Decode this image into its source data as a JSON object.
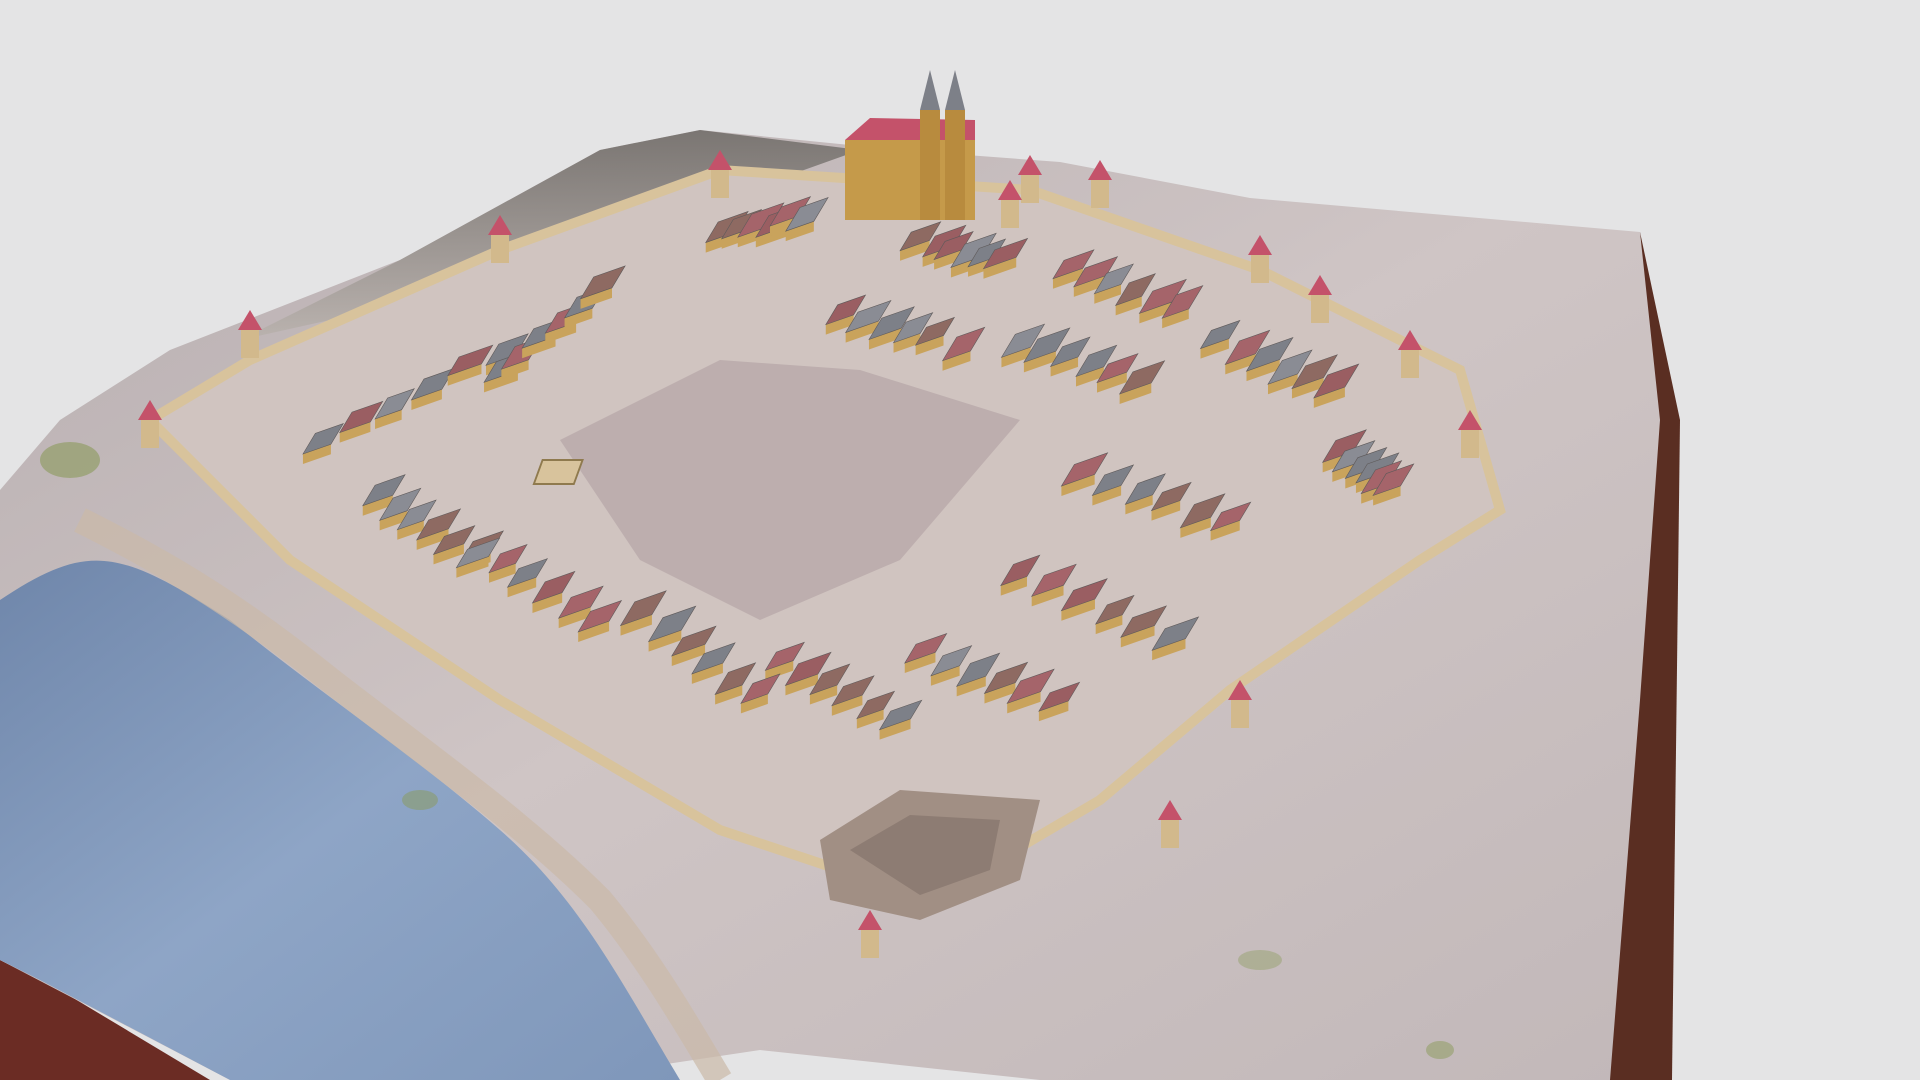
{
  "viewer": {
    "background": "#e4e4e5",
    "subject_icon": "town-model-icon"
  },
  "palette": {
    "ground": "#c9bfc0",
    "ground_dark": "#aea3a6",
    "edge": "#5a2e22",
    "edge_dark": "#3e1d16",
    "water": "#7f97ba",
    "water_light": "#9fb3cf",
    "square": "#bdaeae",
    "wall": "#d8c39c",
    "roof_grey": "#7d8088",
    "roof_red": "#a5646a",
    "roof_brown": "#8e6a62",
    "facade": "#c9a35c",
    "tower_roof": "#c4526a",
    "church": "#c59a4a",
    "moss": "#8a9a5a"
  }
}
